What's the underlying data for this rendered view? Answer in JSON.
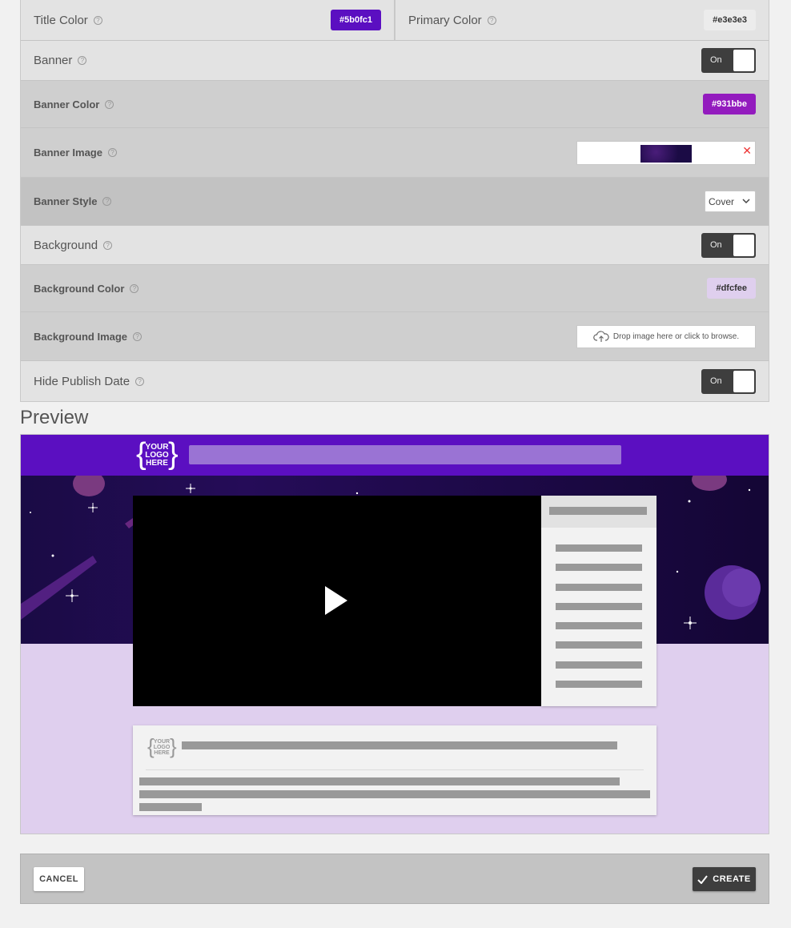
{
  "settings": {
    "title_color": {
      "label": "Title Color",
      "value": "#5b0fc1"
    },
    "primary_color": {
      "label": "Primary Color",
      "value": "#e3e3e3"
    },
    "banner": {
      "label": "Banner",
      "toggle": "On"
    },
    "banner_color": {
      "label": "Banner Color",
      "value": "#931bbe"
    },
    "banner_image": {
      "label": "Banner Image"
    },
    "banner_style": {
      "label": "Banner Style",
      "value": "Cover"
    },
    "background": {
      "label": "Background",
      "toggle": "On"
    },
    "background_color": {
      "label": "Background Color",
      "value": "#dfcfee"
    },
    "background_image": {
      "label": "Background Image",
      "dropzone": "Drop image here or click to browse."
    },
    "hide_publish_date": {
      "label": "Hide Publish Date",
      "toggle": "On"
    }
  },
  "help_glyph": "?",
  "preview": {
    "heading": "Preview",
    "logo_brace_left": "{",
    "logo_brace_right": "}",
    "logo_line1": "YOUR",
    "logo_line2": "LOGO",
    "logo_line3": "HERE"
  },
  "footer": {
    "cancel_label": "CANCEL",
    "create_label": "CREATE"
  },
  "colors": {
    "title": "#5b0fc1",
    "banner": "#931bbe",
    "background": "#dfcfee",
    "dark": "#3e3e3e"
  },
  "icons": {
    "help": "help-circle-icon",
    "remove": "close-icon",
    "dropdown": "chevron-down-icon",
    "upload": "cloud-upload-icon",
    "play": "play-icon",
    "check": "check-icon"
  }
}
